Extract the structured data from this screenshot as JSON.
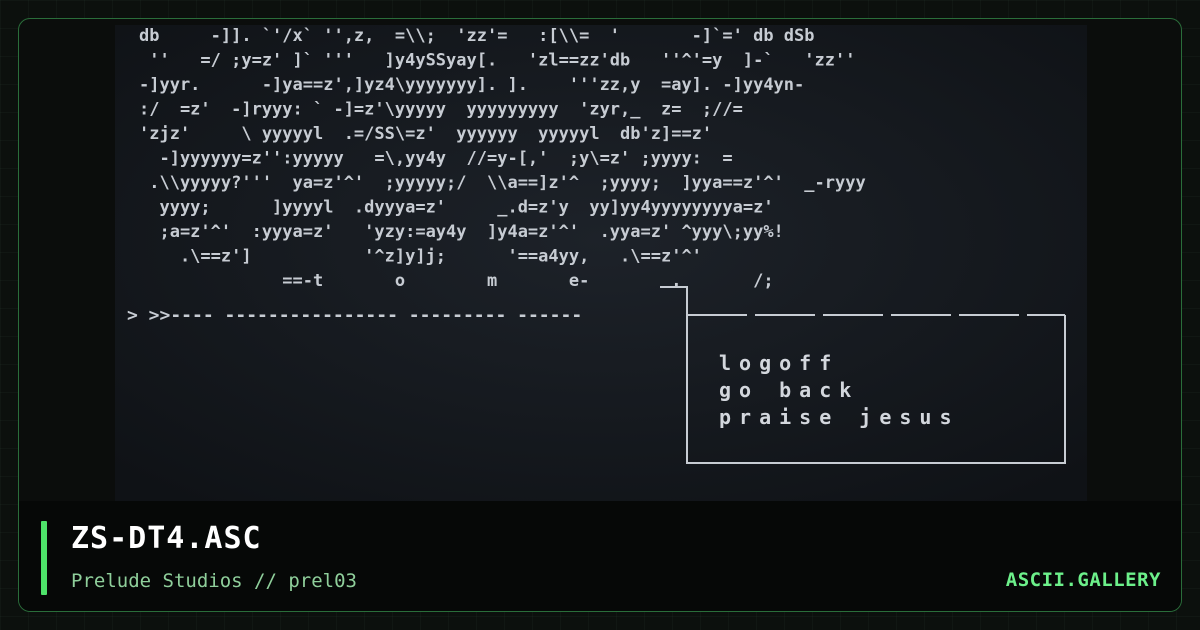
{
  "artwork": {
    "ascii_lines": [
      "db     -]]. `'/x` '',z,  =\\\\;  'zz'=   :[\\\\=  '       -]`=' db dSb",
      " ''   =/ ;y=z' ]` '''   ]y4ySSyay[.   'zl==zz'db   ''^'=y  ]-`   'zz''",
      "-]yyr.      -]ya==z',]yz4\\yyyyyyy]. ].    '''zz,y  =ay]. -]yy4yn-",
      ":/  =z'  -]ryyy: ` -]=z'\\yyyyy  yyyyyyyyy  'zyr,_  z=  ;//=",
      "'zjz'     \\ yyyyyl  .=/SS\\=z'  yyyyyy  yyyyyl  db'z]==z'",
      "  -]yyyyyy=z'':yyyyy   =\\,yy4y  //=y-[,'  ;y\\=z' ;yyyy:  =",
      " .\\\\yyyyy?'''  ya=z'^'  ;yyyyy;/  \\\\a==]z'^  ;yyyy;  ]yya==z'^'  _-ryyy",
      "  yyyy;      ]yyyyl  .dyyya=z'     _.d=z'y  yy]yy4yyyyyyyya=z'",
      "  ;a=z'^'  :yyya=z'   'yzy:=ay4y  ]y4a=z'^'  .yya=z' ^yyy\\;yy%!",
      "    .\\==z']           '^z]y]j;      '==a4yy,   .\\==z'^'",
      "              ==-t       o        m       e-        .       /;"
    ],
    "prompt_line": "> >>----  ----------------  ---------  ------",
    "menu_items": [
      "logoff",
      "go back",
      "praise jesus"
    ]
  },
  "footer": {
    "title": "ZS-DT4.ASC",
    "subtitle": "Prelude Studios // prel03",
    "brand": "ASCII.GALLERY"
  },
  "colors": {
    "accent": "#4ee36a",
    "border": "#2a6d3a",
    "ascii_text": "#c7ccd3",
    "background": "#12151a"
  }
}
